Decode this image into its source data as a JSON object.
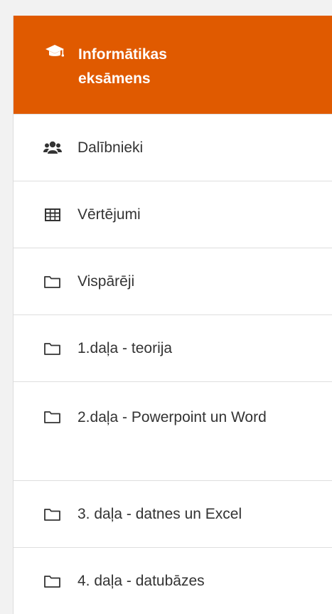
{
  "course": {
    "icon": "graduation-cap-icon",
    "title_line1": "Informātikas",
    "title_line2": "eksāmens",
    "accent": "#e05a00"
  },
  "items": [
    {
      "icon": "users-icon",
      "label": "Dalībnieki"
    },
    {
      "icon": "table-icon",
      "label": "Vērtējumi"
    },
    {
      "icon": "folder-icon",
      "label": "Vispārēji"
    },
    {
      "icon": "folder-icon",
      "label": "1.daļa - teorija"
    },
    {
      "icon": "folder-icon",
      "label": "2.daļa - Powerpoint un Word"
    },
    {
      "icon": "folder-icon",
      "label": "3. daļa - datnes un Excel"
    },
    {
      "icon": "folder-icon",
      "label": "4. daļa - datubāzes"
    }
  ]
}
